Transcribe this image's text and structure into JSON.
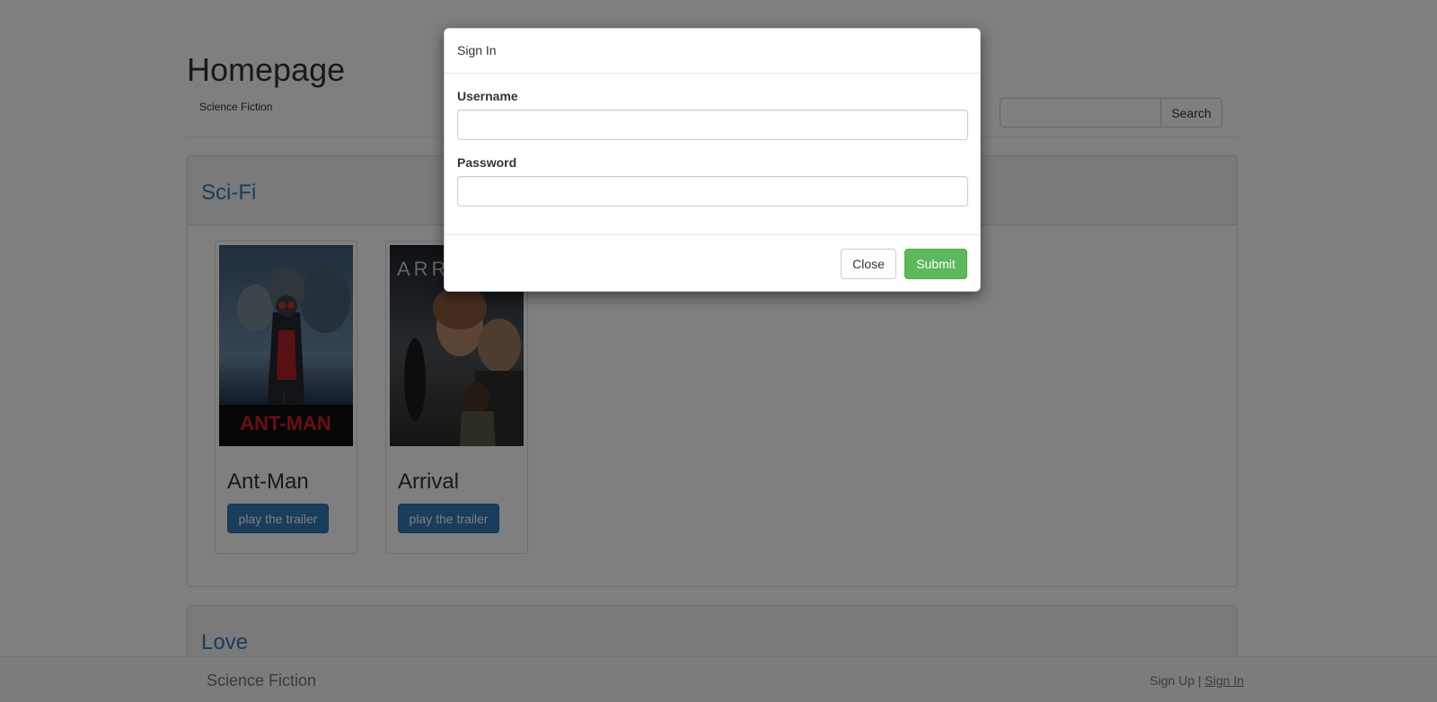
{
  "header": {
    "title": "Homepage",
    "subnav_label": "Science Fiction",
    "search": {
      "value": "",
      "button_label": "Search"
    }
  },
  "sections": [
    {
      "title": "Sci-Fi",
      "movies": [
        {
          "title": "Ant-Man",
          "poster_text": "ANT-MAN",
          "button_label": "play the trailer"
        },
        {
          "title": "Arrival",
          "poster_text": "ARRIVAL",
          "button_label": "play the trailer"
        }
      ]
    },
    {
      "title": "Love",
      "movies": []
    }
  ],
  "footer": {
    "brand": "Science Fiction",
    "signup_label": "Sign Up",
    "separator": "|",
    "signin_label": "Sign In"
  },
  "modal": {
    "title": "Sign In",
    "username_label": "Username",
    "password_label": "Password",
    "username_value": "",
    "password_value": "",
    "close_label": "Close",
    "submit_label": "Submit"
  },
  "colors": {
    "link_blue": "#337ab7",
    "primary_button": "#337ab7",
    "success_button": "#5cb85c",
    "backdrop": "rgba(0,0,0,0.5)"
  }
}
